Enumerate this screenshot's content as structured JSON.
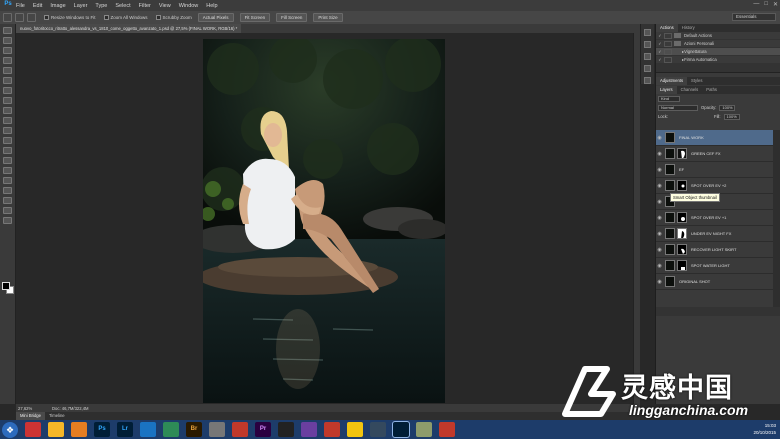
{
  "app": {
    "logo": "Ps"
  },
  "menubar": {
    "items": [
      "File",
      "Edit",
      "Image",
      "Layer",
      "Type",
      "Select",
      "Filter",
      "View",
      "Window",
      "Help"
    ],
    "controls": [
      "—",
      "□",
      "✕"
    ]
  },
  "options": {
    "checkboxes": [
      "Resize Windows to Fit",
      "Zoom All Windows",
      "Scrubby Zoom"
    ],
    "buttons": [
      "Actual Pixels",
      "Fit Screen",
      "Fill Screen",
      "Print Size"
    ],
    "workspace": "Essentials"
  },
  "document": {
    "tab_title": "nuovo_fotoritocco_ritratto_alessandra_vs_1810_come_oggetto_avanzato_1.psd @ 27,5% (FINAL WORK, RGB/16) *",
    "zoom": "27,62%",
    "doc_size": "Doc: 46,7M/322,4M"
  },
  "bottom_tabs": [
    "Mini Bridge",
    "Timeline"
  ],
  "actions_panel": {
    "tabs": [
      "Actions",
      "History"
    ],
    "rows": [
      {
        "check": "✓",
        "label": "Default Actions",
        "type": "folder"
      },
      {
        "check": "✓",
        "label": "Azioni Personali",
        "type": "folder"
      },
      {
        "check": "✓",
        "label": "Vignettatura",
        "type": "action"
      },
      {
        "check": "✓",
        "label": "Firma Automatica",
        "type": "action"
      }
    ]
  },
  "adjustments_panel": {
    "tabs": [
      "Adjustments",
      "Styles"
    ]
  },
  "layers_panel": {
    "tabs": [
      "Layers",
      "Channels",
      "Paths"
    ],
    "kind_label": "Kind",
    "blend_mode": "Normal",
    "opacity_label": "Opacity:",
    "opacity": "100%",
    "lock_label": "Lock:",
    "fill_label": "Fill:",
    "fill": "100%",
    "layers": [
      {
        "name": "FINAL WORK",
        "selected": true
      },
      {
        "name": "GREEN CEF FX",
        "selected": false
      },
      {
        "name": "EF",
        "selected": false
      },
      {
        "name": "SPOT OVER EV +2",
        "selected": false
      },
      {
        "name": "",
        "selected": false
      },
      {
        "name": "SPOT OVER EV +1",
        "selected": false
      },
      {
        "name": "UNDER EV NIGHT FX",
        "selected": false
      },
      {
        "name": "RECOVER LIGHT SKIRT",
        "selected": false
      },
      {
        "name": "SPOT WATER LIGHT",
        "selected": false
      },
      {
        "name": "ORIGINAL SHOT",
        "selected": false
      }
    ],
    "tooltip": "Smart Object thumbnail"
  },
  "taskbar": {
    "apps": [
      "Ps",
      "Lr",
      "Br",
      "Pr"
    ],
    "time": "15:03",
    "date": "20/10/2015"
  },
  "watermark": {
    "cn": "灵感中国",
    "url": "lingganchina.com"
  }
}
